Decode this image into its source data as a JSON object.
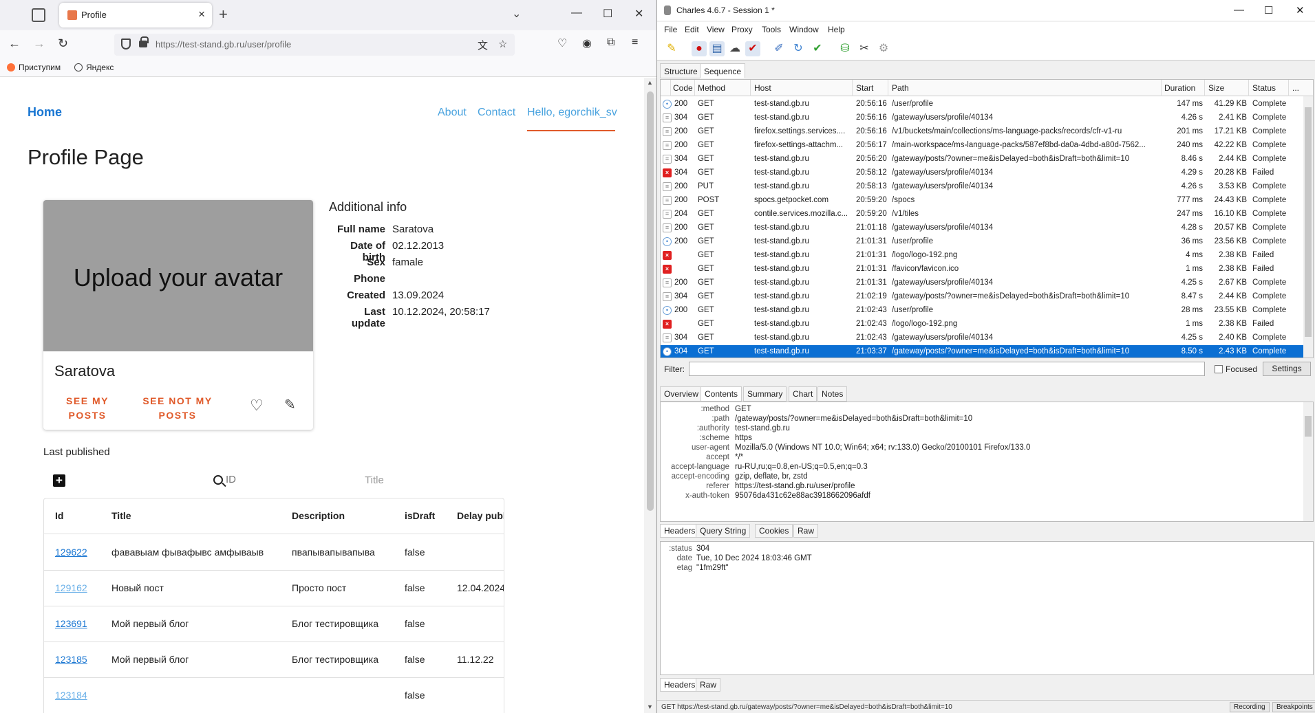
{
  "browser": {
    "tab_title": "Profile",
    "url": "https://test-stand.gb.ru/user/profile",
    "bookmarks": [
      "Приступим",
      "Яндекс"
    ]
  },
  "page": {
    "home": "Home",
    "nav": {
      "about": "About",
      "contact": "Contact",
      "hello": "Hello, egorchik_sv"
    },
    "title": "Profile Page",
    "avatar_text": "Upload your avatar",
    "profile_name": "Saratova",
    "see_my_posts": "SEE MY POSTS",
    "see_not_my_posts": "SEE NOT MY POSTS",
    "additional_info_title": "Additional info",
    "info": [
      {
        "k": "Full name",
        "v": "Saratova"
      },
      {
        "k": "Date of birth",
        "v": "02.12.2013"
      },
      {
        "k": "Sex",
        "v": "famale"
      },
      {
        "k": "Phone",
        "v": ""
      },
      {
        "k": "Created",
        "v": "13.09.2024"
      },
      {
        "k": "Last update",
        "v": "10.12.2024, 20:58:17"
      }
    ],
    "last_published": "Last published",
    "search_id_placeholder": "ID",
    "search_title_placeholder": "Title",
    "table": {
      "headers": [
        "Id",
        "Title",
        "Description",
        "isDraft",
        "Delay publi"
      ],
      "rows": [
        {
          "id": "129622",
          "title": "фававыам фывафывс амфываыв",
          "description": "пвапывапывапыва",
          "isDraft": "false",
          "delay": ""
        },
        {
          "id": "129162",
          "title": "Новый пост",
          "description": "Просто пост",
          "isDraft": "false",
          "delay": "12.04.2024"
        },
        {
          "id": "123691",
          "title": "Мой первый блог",
          "description": "Блог тестировщика",
          "isDraft": "false",
          "delay": ""
        },
        {
          "id": "123185",
          "title": "Мой первый блог",
          "description": "Блог тестировщика",
          "isDraft": "false",
          "delay": "11.12.22"
        },
        {
          "id": "123184",
          "title": "",
          "description": "",
          "isDraft": "false",
          "delay": ""
        }
      ]
    }
  },
  "charles": {
    "title": "Charles 4.6.7 - Session 1 *",
    "menu": [
      "File",
      "Edit",
      "View",
      "Proxy",
      "Tools",
      "Window",
      "Help"
    ],
    "view_tabs": [
      "Structure",
      "Sequence"
    ],
    "columns": [
      "Code",
      "Method",
      "Host",
      "Start",
      "Path",
      "Duration",
      "Size",
      "Status",
      "..."
    ],
    "rows": [
      {
        "icon": "ok",
        "code": "200",
        "method": "GET",
        "host": "test-stand.gb.ru",
        "start": "20:56:16",
        "path": "/user/profile",
        "duration": "147 ms",
        "size": "41.29 KB",
        "status": "Complete"
      },
      {
        "icon": "doc",
        "code": "304",
        "method": "GET",
        "host": "test-stand.gb.ru",
        "start": "20:56:16",
        "path": "/gateway/users/profile/40134",
        "duration": "4.26 s",
        "size": "2.41 KB",
        "status": "Complete"
      },
      {
        "icon": "doc",
        "code": "200",
        "method": "GET",
        "host": "firefox.settings.services....",
        "start": "20:56:16",
        "path": "/v1/buckets/main/collections/ms-language-packs/records/cfr-v1-ru",
        "duration": "201 ms",
        "size": "17.21 KB",
        "status": "Complete"
      },
      {
        "icon": "doc",
        "code": "200",
        "method": "GET",
        "host": "firefox-settings-attachm...",
        "start": "20:56:17",
        "path": "/main-workspace/ms-language-packs/587ef8bd-da0a-4dbd-a80d-7562...",
        "duration": "240 ms",
        "size": "42.22 KB",
        "status": "Complete"
      },
      {
        "icon": "doc",
        "code": "304",
        "method": "GET",
        "host": "test-stand.gb.ru",
        "start": "20:56:20",
        "path": "/gateway/posts/?owner=me&isDelayed=both&isDraft=both&limit=10",
        "duration": "8.46 s",
        "size": "2.44 KB",
        "status": "Complete"
      },
      {
        "icon": "err",
        "code": "304",
        "method": "GET",
        "host": "test-stand.gb.ru",
        "start": "20:58:12",
        "path": "/gateway/users/profile/40134",
        "duration": "4.29 s",
        "size": "20.28 KB",
        "status": "Failed"
      },
      {
        "icon": "doc",
        "code": "200",
        "method": "PUT",
        "host": "test-stand.gb.ru",
        "start": "20:58:13",
        "path": "/gateway/users/profile/40134",
        "duration": "4.26 s",
        "size": "3.53 KB",
        "status": "Complete"
      },
      {
        "icon": "doc",
        "code": "200",
        "method": "POST",
        "host": "spocs.getpocket.com",
        "start": "20:59:20",
        "path": "/spocs",
        "duration": "777 ms",
        "size": "24.43 KB",
        "status": "Complete"
      },
      {
        "icon": "doc",
        "code": "204",
        "method": "GET",
        "host": "contile.services.mozilla.c...",
        "start": "20:59:20",
        "path": "/v1/tiles",
        "duration": "247 ms",
        "size": "16.10 KB",
        "status": "Complete"
      },
      {
        "icon": "doc",
        "code": "200",
        "method": "GET",
        "host": "test-stand.gb.ru",
        "start": "21:01:18",
        "path": "/gateway/users/profile/40134",
        "duration": "4.28 s",
        "size": "20.57 KB",
        "status": "Complete"
      },
      {
        "icon": "ok",
        "code": "200",
        "method": "GET",
        "host": "test-stand.gb.ru",
        "start": "21:01:31",
        "path": "/user/profile",
        "duration": "36 ms",
        "size": "23.56 KB",
        "status": "Complete"
      },
      {
        "icon": "err",
        "code": "",
        "method": "GET",
        "host": "test-stand.gb.ru",
        "start": "21:01:31",
        "path": "/logo/logo-192.png",
        "duration": "4 ms",
        "size": "2.38 KB",
        "status": "Failed"
      },
      {
        "icon": "err",
        "code": "",
        "method": "GET",
        "host": "test-stand.gb.ru",
        "start": "21:01:31",
        "path": "/favicon/favicon.ico",
        "duration": "1 ms",
        "size": "2.38 KB",
        "status": "Failed"
      },
      {
        "icon": "doc",
        "code": "200",
        "method": "GET",
        "host": "test-stand.gb.ru",
        "start": "21:01:31",
        "path": "/gateway/users/profile/40134",
        "duration": "4.25 s",
        "size": "2.67 KB",
        "status": "Complete"
      },
      {
        "icon": "doc",
        "code": "304",
        "method": "GET",
        "host": "test-stand.gb.ru",
        "start": "21:02:19",
        "path": "/gateway/posts/?owner=me&isDelayed=both&isDraft=both&limit=10",
        "duration": "8.47 s",
        "size": "2.44 KB",
        "status": "Complete"
      },
      {
        "icon": "ok",
        "code": "200",
        "method": "GET",
        "host": "test-stand.gb.ru",
        "start": "21:02:43",
        "path": "/user/profile",
        "duration": "28 ms",
        "size": "23.55 KB",
        "status": "Complete"
      },
      {
        "icon": "err",
        "code": "",
        "method": "GET",
        "host": "test-stand.gb.ru",
        "start": "21:02:43",
        "path": "/logo/logo-192.png",
        "duration": "1 ms",
        "size": "2.38 KB",
        "status": "Failed"
      },
      {
        "icon": "doc",
        "code": "304",
        "method": "GET",
        "host": "test-stand.gb.ru",
        "start": "21:02:43",
        "path": "/gateway/users/profile/40134",
        "duration": "4.25 s",
        "size": "2.40 KB",
        "status": "Complete"
      },
      {
        "icon": "ok",
        "code": "304",
        "method": "GET",
        "host": "test-stand.gb.ru",
        "start": "21:03:37",
        "path": "/gateway/posts/?owner=me&isDelayed=both&isDraft=both&limit=10",
        "duration": "8.50 s",
        "size": "2.43 KB",
        "status": "Complete",
        "selected": true
      }
    ],
    "filter_label": "Filter:",
    "focused_label": "Focused",
    "settings_label": "Settings",
    "detail_tabs": [
      "Overview",
      "Contents",
      "Summary",
      "Chart",
      "Notes"
    ],
    "request_headers": [
      {
        "k": ":method",
        "v": "GET"
      },
      {
        "k": ":path",
        "v": "/gateway/posts/?owner=me&isDelayed=both&isDraft=both&limit=10"
      },
      {
        "k": ":authority",
        "v": "test-stand.gb.ru"
      },
      {
        "k": ":scheme",
        "v": "https"
      },
      {
        "k": "user-agent",
        "v": "Mozilla/5.0 (Windows NT 10.0; Win64; x64; rv:133.0) Gecko/20100101 Firefox/133.0"
      },
      {
        "k": "accept",
        "v": "*/*"
      },
      {
        "k": "accept-language",
        "v": "ru-RU,ru;q=0.8,en-US;q=0.5,en;q=0.3"
      },
      {
        "k": "accept-encoding",
        "v": "gzip, deflate, br, zstd"
      },
      {
        "k": "referer",
        "v": "https://test-stand.gb.ru/user/profile"
      },
      {
        "k": "x-auth-token",
        "v": "95076da431c62e88ac3918662096afdf"
      }
    ],
    "request_tabs": [
      "Headers",
      "Query String",
      "Cookies",
      "Raw"
    ],
    "response_headers": [
      {
        "k": ":status",
        "v": "304"
      },
      {
        "k": "date",
        "v": "Tue, 10 Dec 2024 18:03:46 GMT"
      },
      {
        "k": "etag",
        "v": "\"1fm29ft\""
      }
    ],
    "response_tabs": [
      "Headers",
      "Raw"
    ],
    "status_url": "GET https://test-stand.gb.ru/gateway/posts/?owner=me&isDelayed=both&isDraft=both&limit=10",
    "status_recording": "Recording",
    "status_breakpoints": "Breakpoints"
  }
}
